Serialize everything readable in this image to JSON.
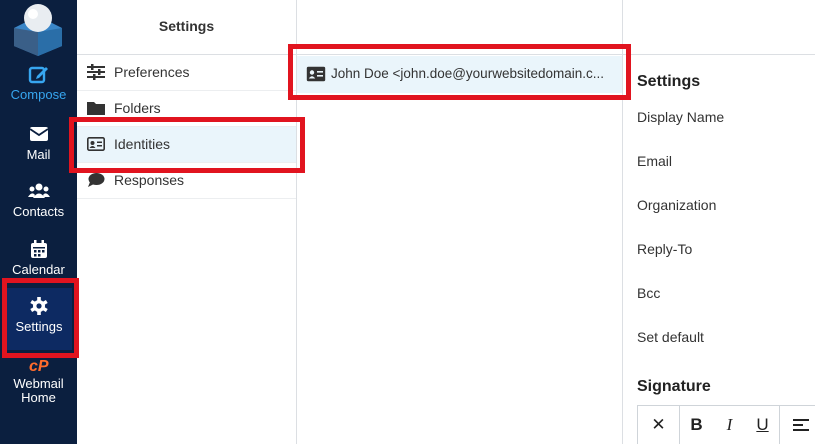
{
  "nav": {
    "compose": "Compose",
    "mail": "Mail",
    "contacts": "Contacts",
    "calendar": "Calendar",
    "settings": "Settings",
    "home": [
      "Webmail",
      "Home"
    ]
  },
  "settings_menu": {
    "header": "Settings",
    "items": [
      {
        "label": "Preferences",
        "icon": "sliders-icon"
      },
      {
        "label": "Folders",
        "icon": "folder-icon"
      },
      {
        "label": "Identities",
        "icon": "id-card-icon"
      },
      {
        "label": "Responses",
        "icon": "comment-icon"
      }
    ]
  },
  "identities": {
    "header": "",
    "items": [
      {
        "label": "John Doe <john.doe@yourwebsitedomain.c..."
      }
    ]
  },
  "details": {
    "header": "",
    "section_title": "Settings",
    "fields": [
      "Display Name",
      "Email",
      "Organization",
      "Reply-To",
      "Bcc",
      "Set default"
    ],
    "signature_title": "Signature",
    "toolbar": {
      "clear": "✕",
      "bold": "B",
      "italic": "I",
      "underline": "U"
    }
  },
  "colors": {
    "nav_bg": "#0b1f3f",
    "accent": "#37a6f0",
    "highlight": "#e1141f",
    "cpanel": "#ff6c2c"
  }
}
